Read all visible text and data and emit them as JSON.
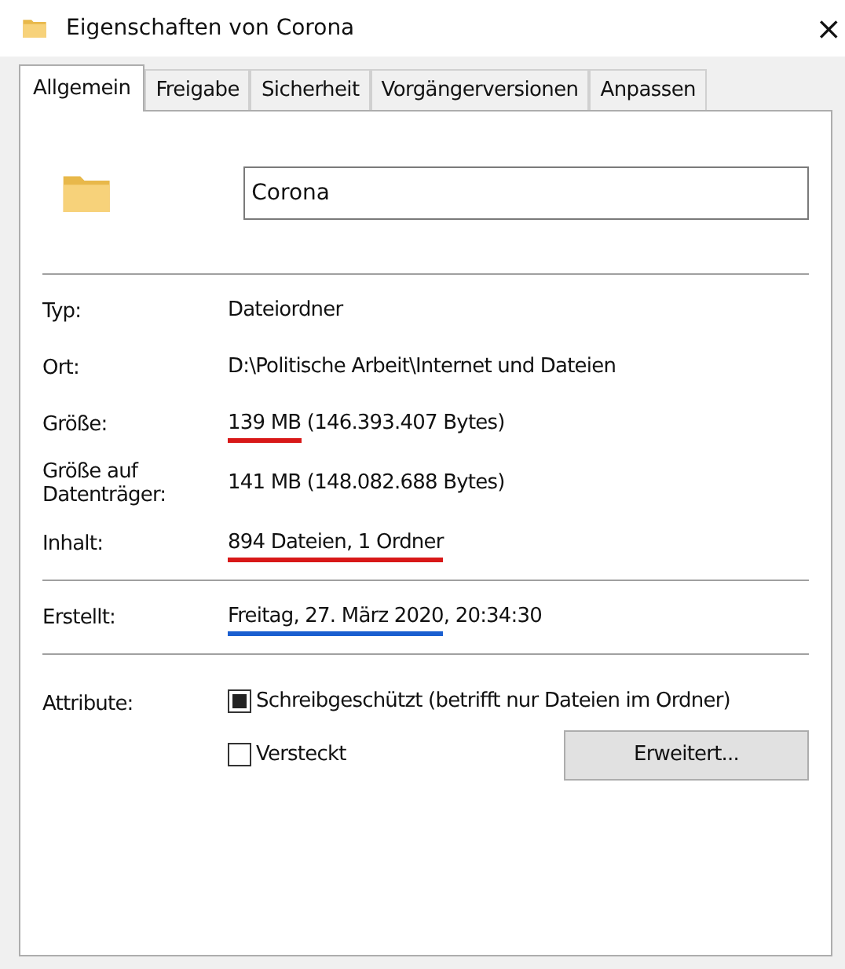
{
  "window": {
    "title": "Eigenschaften von Corona",
    "close": "×"
  },
  "tabs": [
    {
      "label": "Allgemein",
      "selected": true
    },
    {
      "label": "Freigabe",
      "selected": false
    },
    {
      "label": "Sicherheit",
      "selected": false
    },
    {
      "label": "Vorgängerversionen",
      "selected": false
    },
    {
      "label": "Anpassen",
      "selected": false
    }
  ],
  "name_field": {
    "value": "Corona"
  },
  "sections": [
    {
      "rows": [
        {
          "label": "Typ:",
          "parts": [
            {
              "text": "Dateiordner"
            }
          ]
        },
        {
          "label": "Ort:",
          "parts": [
            {
              "text": "D:\\Politische Arbeit\\Internet und Dateien"
            }
          ]
        },
        {
          "label": "Größe:",
          "parts": [
            {
              "text": "139 MB",
              "color": "#d81818"
            },
            {
              "text": " (146.393.407 Bytes)"
            }
          ]
        },
        {
          "label": "Größe auf Datenträger:",
          "parts": [
            {
              "text": "141 MB (148.082.688 Bytes)"
            }
          ]
        },
        {
          "label": "Inhalt:",
          "parts": [
            {
              "text": "894 Dateien, 1 Ordner",
              "color": "#d81818"
            }
          ]
        }
      ]
    },
    {
      "rows": [
        {
          "label": "Erstellt:",
          "parts": [
            {
              "text": "Freitag, 27. März 2020",
              "color": "#1a5fd0"
            },
            {
              "text": ", 20:34:30"
            }
          ]
        }
      ]
    }
  ],
  "attributes": {
    "label": "Attribute:",
    "items": [
      {
        "label": "Schreibgeschützt (betrifft nur Dateien im Ordner)",
        "indeterminate": true
      },
      {
        "label": "Versteckt",
        "checked": false,
        "indeterminate": false
      }
    ],
    "button": "Erweitert..."
  }
}
